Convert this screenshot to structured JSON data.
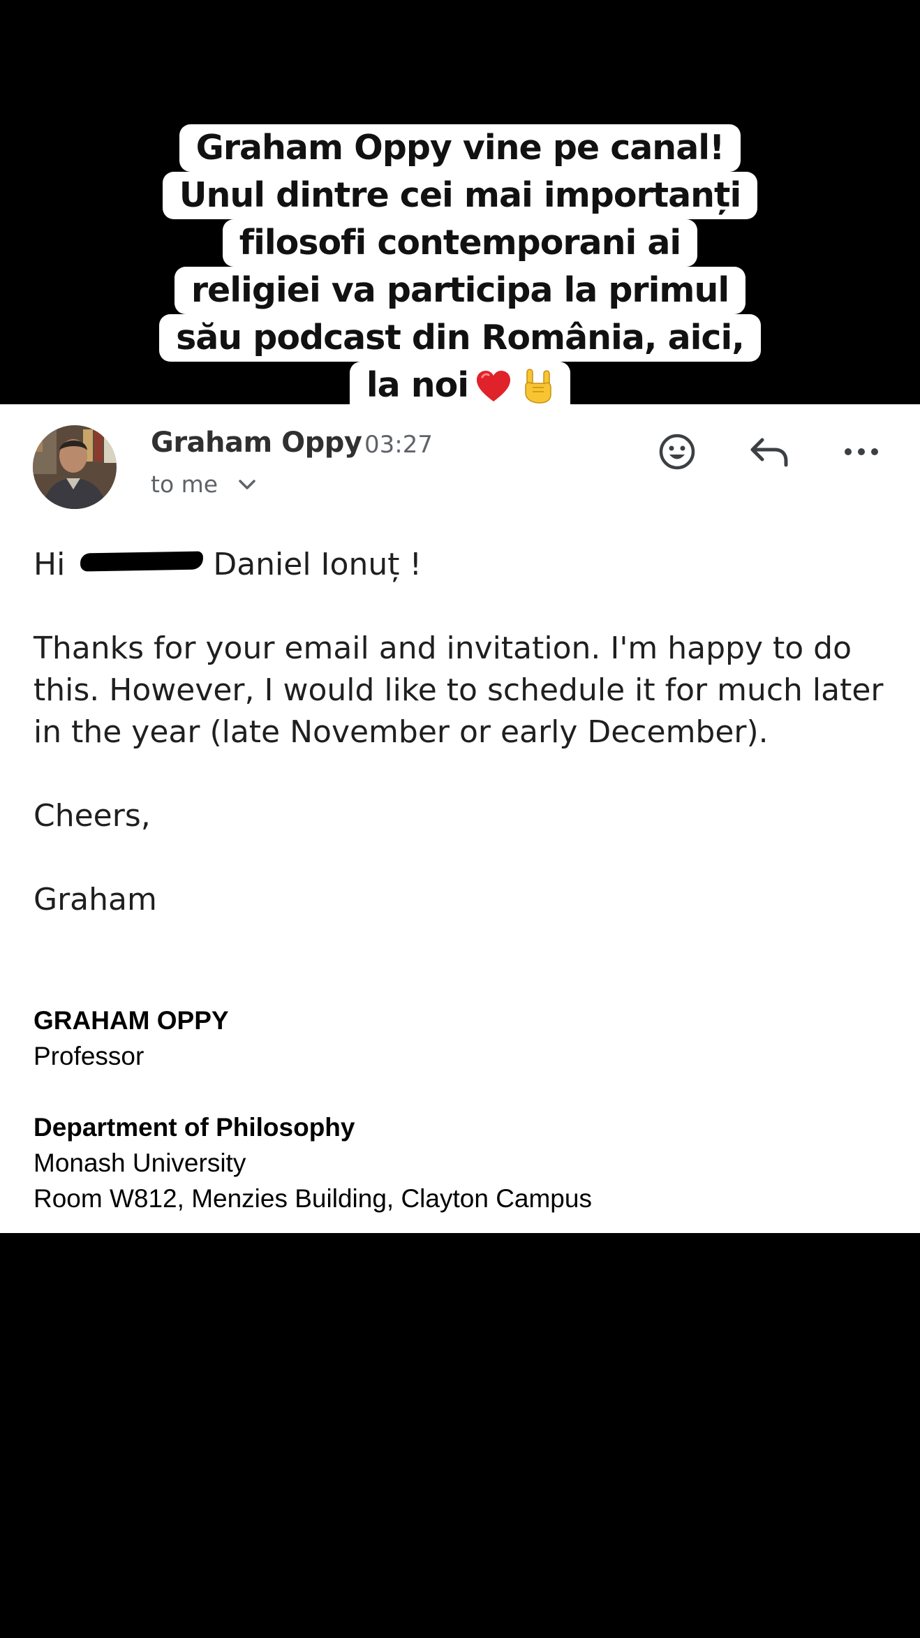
{
  "caption": {
    "lines": [
      "Graham Oppy vine pe canal!",
      "Unul dintre cei mai importanți",
      "filosofi contemporani ai",
      "religiei va participa la primul",
      "său podcast din România, aici,",
      "la noi"
    ],
    "emojis": [
      "red-heart-icon",
      "sign-of-the-horns-icon"
    ]
  },
  "email": {
    "sender_name": "Graham Oppy",
    "time": "03:27",
    "recipient": "to me",
    "greeting_prefix": "Hi",
    "greeting_name": "Daniel Ionuț  !",
    "paragraph_lines": [
      "Thanks for your email and invitation. I'm happy to do",
      "this. However, I would like to schedule it for much later",
      "in the year (late November or early December)."
    ],
    "closing": "Cheers,",
    "sign_name": "Graham",
    "signature": {
      "name": "GRAHAM OPPY",
      "title": "Professor",
      "department": "Department of Philosophy",
      "university": "Monash University",
      "address": "Room W812, Menzies Building, Clayton Campus"
    },
    "actions": [
      "emoji-reaction-icon",
      "reply-icon",
      "more-options-icon"
    ]
  },
  "colors": {
    "background": "#000000",
    "card": "#ffffff",
    "secondary_text": "#5f6368",
    "heart": "#e0222b",
    "hand": "#f7c531"
  }
}
